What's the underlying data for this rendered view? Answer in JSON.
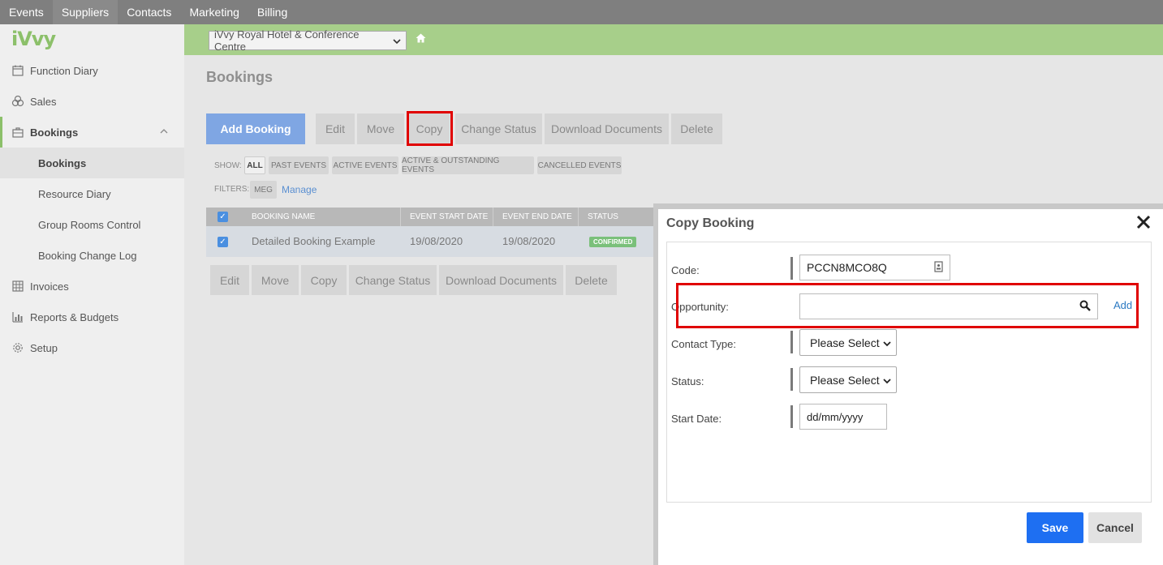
{
  "topnav": {
    "items": [
      "Events",
      "Suppliers",
      "Contacts",
      "Marketing",
      "Billing"
    ],
    "active": "Suppliers"
  },
  "brand": {
    "logo": "iVvy",
    "accent": "#8cc06a"
  },
  "sidebar": {
    "items": [
      {
        "label": "Function Diary",
        "icon": "calendar-icon"
      },
      {
        "label": "Sales",
        "icon": "sales-icon"
      },
      {
        "label": "Bookings",
        "icon": "briefcase-icon"
      },
      {
        "label": "Bookings"
      },
      {
        "label": "Resource Diary"
      },
      {
        "label": "Group Rooms Control"
      },
      {
        "label": "Booking Change Log"
      },
      {
        "label": "Invoices",
        "icon": "grid-icon"
      },
      {
        "label": "Reports & Budgets",
        "icon": "bar-chart-icon"
      },
      {
        "label": "Setup",
        "icon": "gear-icon"
      }
    ]
  },
  "venue": {
    "selected": "iVvy Royal Hotel & Conference Centre"
  },
  "page": {
    "title": "Bookings"
  },
  "toolbar": {
    "add": "Add Booking",
    "edit": "Edit",
    "move": "Move",
    "copy": "Copy",
    "change_status": "Change Status",
    "download_documents": "Download Documents",
    "delete": "Delete"
  },
  "filters": {
    "show_label": "SHOW:",
    "show_options": [
      "ALL",
      "PAST EVENTS",
      "ACTIVE EVENTS",
      "ACTIVE & OUTSTANDING EVENTS",
      "CANCELLED EVENTS"
    ],
    "filters_label": "FILTERS:",
    "filter_tag": "MEG",
    "manage": "Manage"
  },
  "table": {
    "columns": [
      "BOOKING NAME",
      "EVENT START DATE",
      "EVENT END DATE",
      "STATUS"
    ],
    "rows": [
      {
        "name": "Detailed Booking Example",
        "start": "19/08/2020",
        "end": "19/08/2020",
        "status": "CONFIRMED"
      }
    ]
  },
  "modal": {
    "title": "Copy Booking",
    "code_label": "Code:",
    "code_value": "PCCN8MCO8Q",
    "opportunity_label": "Opportunity:",
    "opportunity_value": "",
    "add_link": "Add",
    "contact_type_label": "Contact Type:",
    "contact_type_value": "Please Select",
    "status_label": "Status:",
    "status_value": "Please Select",
    "start_date_label": "Start Date:",
    "start_date_placeholder": "dd/mm/yyyy",
    "save": "Save",
    "cancel": "Cancel"
  }
}
